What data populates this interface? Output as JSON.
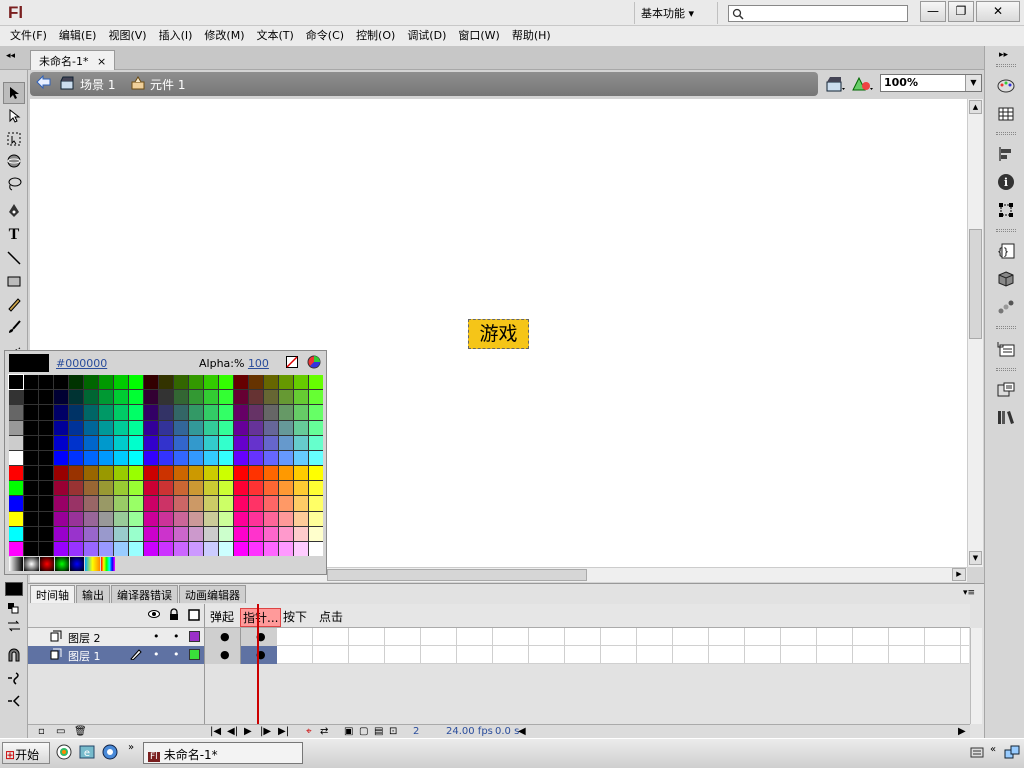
{
  "app": {
    "logo": "Fl",
    "workspace": "基本功能"
  },
  "menu": [
    "文件(F)",
    "编辑(E)",
    "视图(V)",
    "插入(I)",
    "修改(M)",
    "文本(T)",
    "命令(C)",
    "控制(O)",
    "调试(D)",
    "窗口(W)",
    "帮助(H)"
  ],
  "document": {
    "tab_label": "未命名-1*",
    "close_glyph": "×"
  },
  "editbar": {
    "scene_label": "场景 1",
    "symbol_label": "元件 1",
    "zoom": "100%"
  },
  "stage": {
    "button_text": "游戏",
    "button_color": "#f5c518"
  },
  "swatch": {
    "current_hex": "#000000",
    "alpha_label": "Alpha:%",
    "alpha_value": "100"
  },
  "timeline": {
    "tabs": [
      "时间轴",
      "输出",
      "编译器错误",
      "动画编辑器"
    ],
    "frame_labels": [
      "弹起",
      "指针...",
      "按下",
      "点击"
    ],
    "layers": [
      {
        "name": "图层 2",
        "color": "#9b30c8"
      },
      {
        "name": "图层 1",
        "color": "#3adf3a"
      }
    ],
    "current_frame": "2",
    "fps": "24.00 fps",
    "elapsed": "0.0 s"
  },
  "taskbar": {
    "start_label": "开始",
    "task_label": "未命名-1*",
    "task_icon": "Fl"
  }
}
